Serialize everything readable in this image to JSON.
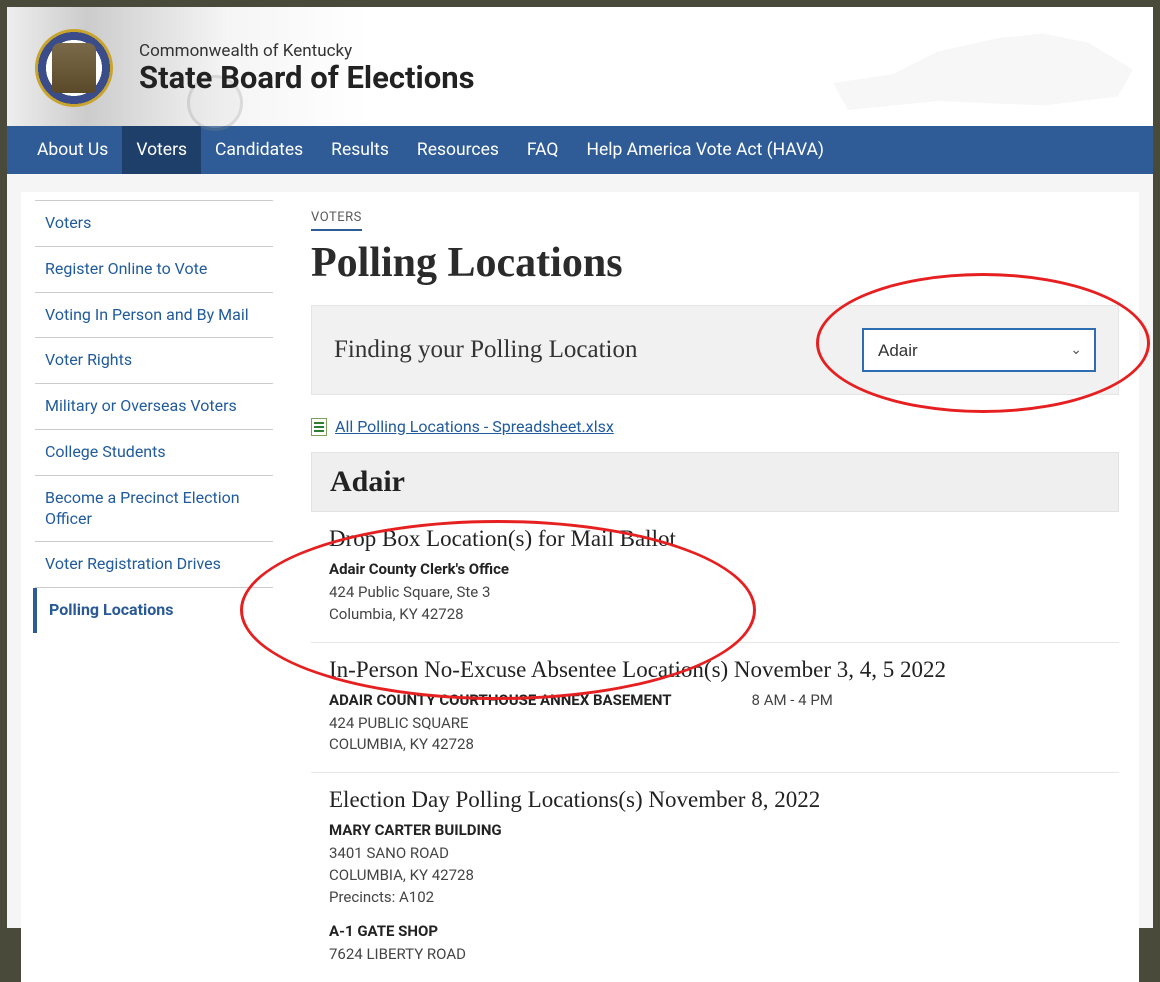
{
  "header": {
    "small": "Commonwealth of Kentucky",
    "large": "State Board of Elections"
  },
  "nav": {
    "items": [
      "About Us",
      "Voters",
      "Candidates",
      "Results",
      "Resources",
      "FAQ",
      "Help America Vote Act (HAVA)"
    ],
    "active_index": 1
  },
  "sidebar": {
    "items": [
      "Voters",
      "Register Online to Vote",
      "Voting In Person and By Mail",
      "Voter Rights",
      "Military or Overseas Voters",
      "College Students",
      "Become a Precinct Election Officer",
      "Voter Registration Drives",
      "Polling Locations"
    ],
    "current_index": 8
  },
  "crumb": "VOTERS",
  "page_title": "Polling Locations",
  "finder": {
    "label": "Finding your Polling Location",
    "selected": "Adair"
  },
  "download": {
    "text": "All Polling Locations - Spreadsheet.xlsx"
  },
  "county": {
    "name": "Adair",
    "sections": [
      {
        "title": "Drop Box Location(s) for Mail Ballot",
        "locations": [
          {
            "name": "Adair County Clerk's Office",
            "line1": "424 Public Square, Ste 3",
            "line2": "Columbia, KY 42728"
          }
        ]
      },
      {
        "title": "In-Person No-Excuse Absentee Location(s) November 3, 4, 5 2022",
        "locations": [
          {
            "name": "ADAIR COUNTY COURTHOUSE ANNEX BASEMENT",
            "line1": "424 PUBLIC SQUARE",
            "line2": "COLUMBIA, KY 42728",
            "hours": "8 AM - 4 PM"
          }
        ]
      },
      {
        "title": "Election Day Polling Locations(s) November 8, 2022",
        "locations": [
          {
            "name": "MARY CARTER BUILDING",
            "line1": "3401 SANO ROAD",
            "line2": "COLUMBIA, KY 42728",
            "precincts": "Precincts: A102"
          },
          {
            "name": "A-1 GATE SHOP",
            "line1": "7624 LIBERTY ROAD"
          }
        ]
      }
    ]
  }
}
